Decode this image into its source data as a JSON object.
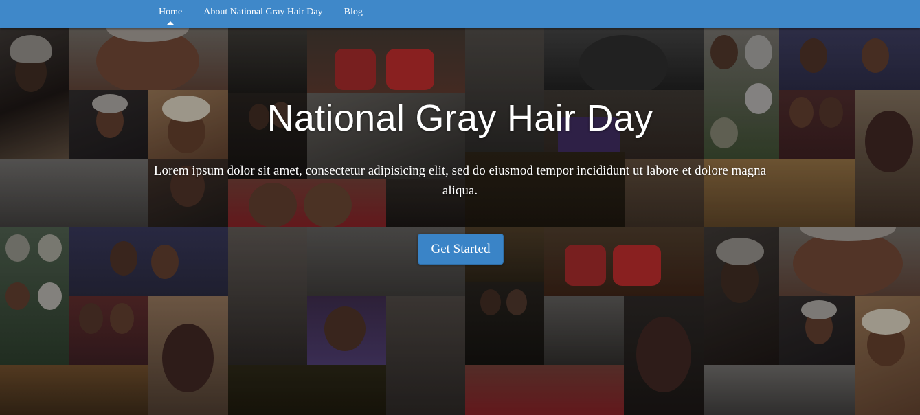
{
  "nav": {
    "items": [
      {
        "label": "Home",
        "active": true
      },
      {
        "label": "About National Gray Hair Day",
        "active": false
      },
      {
        "label": "Blog",
        "active": false
      }
    ],
    "bar_color": "#3f88c9"
  },
  "hero": {
    "title": "National Gray Hair Day",
    "text": "Lorem ipsum dolor sit amet, consectetur adipisicing elit, sed do eiusmod tempor incididunt ut labore et dolore magna aliqua.",
    "cta_label": "Get Started",
    "background": "photo-collage"
  },
  "colors": {
    "accent": "#3a84c7",
    "text": "#ffffff"
  }
}
